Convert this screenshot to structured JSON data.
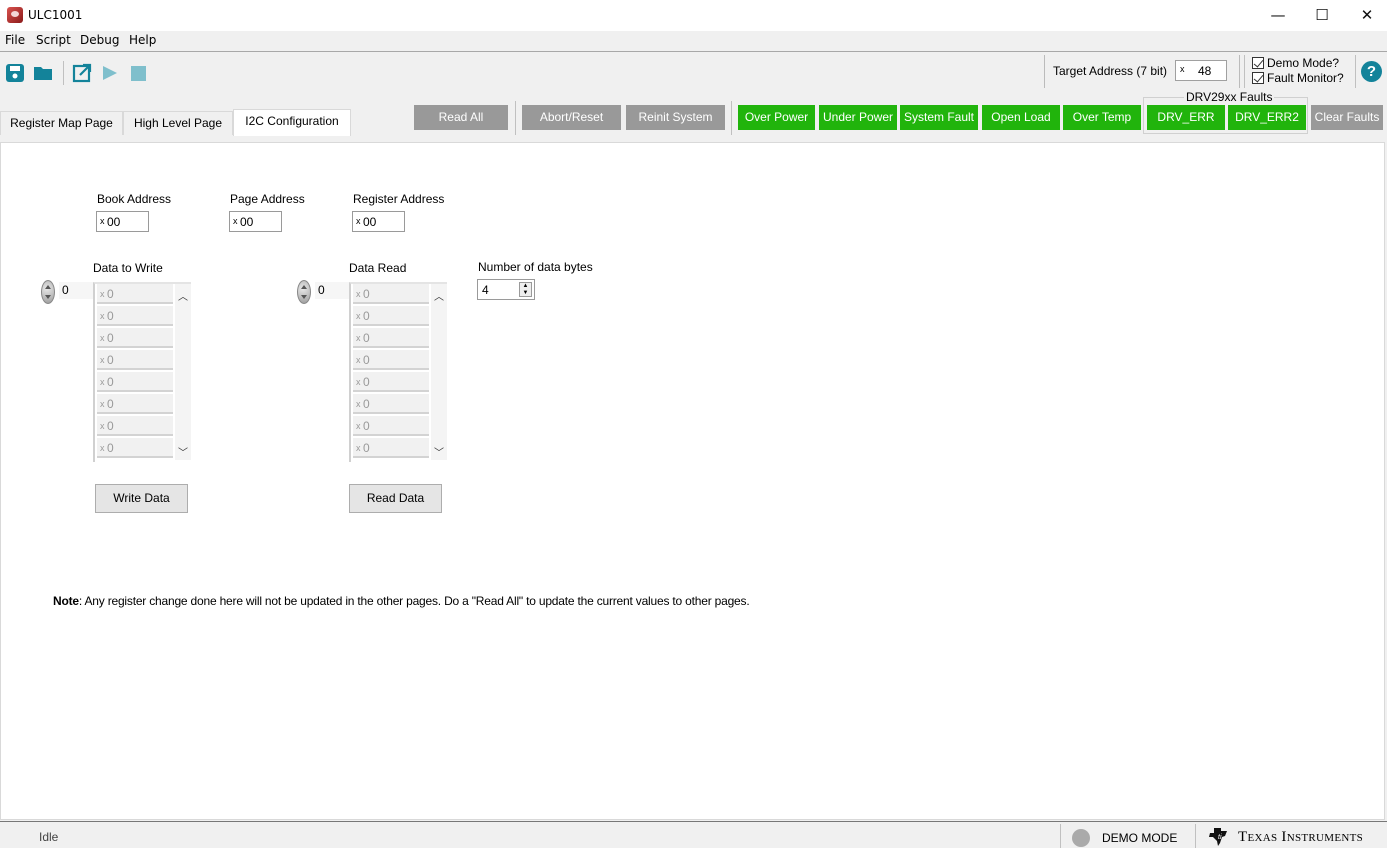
{
  "window": {
    "title": "ULC1001",
    "controls": {
      "minimize": "—",
      "maximize": "☐",
      "close": "✕"
    }
  },
  "menu": [
    "File",
    "Script",
    "Debug",
    "Help"
  ],
  "toolbar": {
    "icons": [
      "save-icon",
      "open-folder-icon",
      "external-link-icon",
      "play-icon",
      "stop-icon"
    ],
    "target_address_label": "Target Address (7 bit)",
    "target_address_prefix": "x",
    "target_address_value": "48",
    "demo_mode_label": "Demo Mode?",
    "demo_mode_checked": true,
    "fault_monitor_label": "Fault Monitor?",
    "fault_monitor_checked": true,
    "help_label": "?"
  },
  "tabs": [
    {
      "label": "Register Map Page",
      "active": false
    },
    {
      "label": "High Level Page",
      "active": false
    },
    {
      "label": "I2C Configuration",
      "active": true
    }
  ],
  "actions": {
    "read_all": "Read All",
    "abort_reset": "Abort/Reset",
    "reinit_system": "Reinit System"
  },
  "faults": {
    "over_power": "Over Power",
    "under_power": "Under Power",
    "system_fault": "System Fault",
    "open_load": "Open Load",
    "over_temp": "Over Temp",
    "drv_group_label": "DRV29xx Faults",
    "drv_err": "DRV_ERR",
    "drv_err2": "DRV_ERR2",
    "clear_faults": "Clear Faults",
    "colors": {
      "active": "#21b40c",
      "inactive": "#999999"
    }
  },
  "i2c": {
    "book_address": {
      "label": "Book Address",
      "prefix": "x",
      "value": "00"
    },
    "page_address": {
      "label": "Page Address",
      "prefix": "x",
      "value": "00"
    },
    "register_address": {
      "label": "Register Address",
      "prefix": "x",
      "value": "00"
    },
    "data_to_write": {
      "label": "Data to Write",
      "index": "0",
      "values": [
        "0",
        "0",
        "0",
        "0",
        "0",
        "0",
        "0",
        "0"
      ]
    },
    "data_read": {
      "label": "Data Read",
      "index": "0",
      "values": [
        "0",
        "0",
        "0",
        "0",
        "0",
        "0",
        "0",
        "0"
      ]
    },
    "num_bytes": {
      "label": "Number of data bytes",
      "value": "4"
    },
    "write_button": "Write Data",
    "read_button": "Read Data",
    "hex_prefix": "x",
    "note_bold": "Note",
    "note_text": ": Any register change done here will not be updated in the other pages. Do a \"Read All\" to update the current values to other pages."
  },
  "status": {
    "text": "Idle",
    "mode_label": "DEMO MODE",
    "brand": "Texas Instruments"
  }
}
